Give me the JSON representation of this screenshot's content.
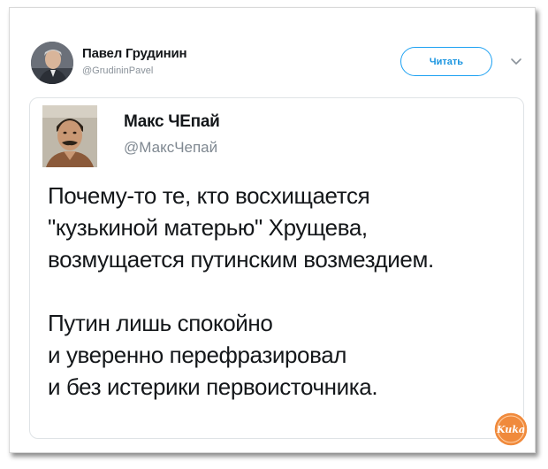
{
  "tweet": {
    "author_name": "Павел Грудинин",
    "author_handle": "@GrudininPavel",
    "follow_label": "Читать",
    "menu_icon": "chevron-down-icon"
  },
  "quoted_tweet": {
    "author_name": "Макс ЧЕпай",
    "author_handle": "@МаксЧепай",
    "paragraph1": [
      "Почему-то те, кто восхищается",
      "\"кузькиной матерью\" Хрущева,",
      "возмущается путинским возмездием."
    ],
    "paragraph2": [
      "Путин лишь спокойно",
      "и уверенно перефразировал",
      "и без истерики первоисточника."
    ]
  },
  "watermark": {
    "text": "Kuka",
    "color": "#f08a3c"
  },
  "colors": {
    "accent": "#1da1f2",
    "text": "#14171a",
    "secondary_text": "#8a929a"
  }
}
